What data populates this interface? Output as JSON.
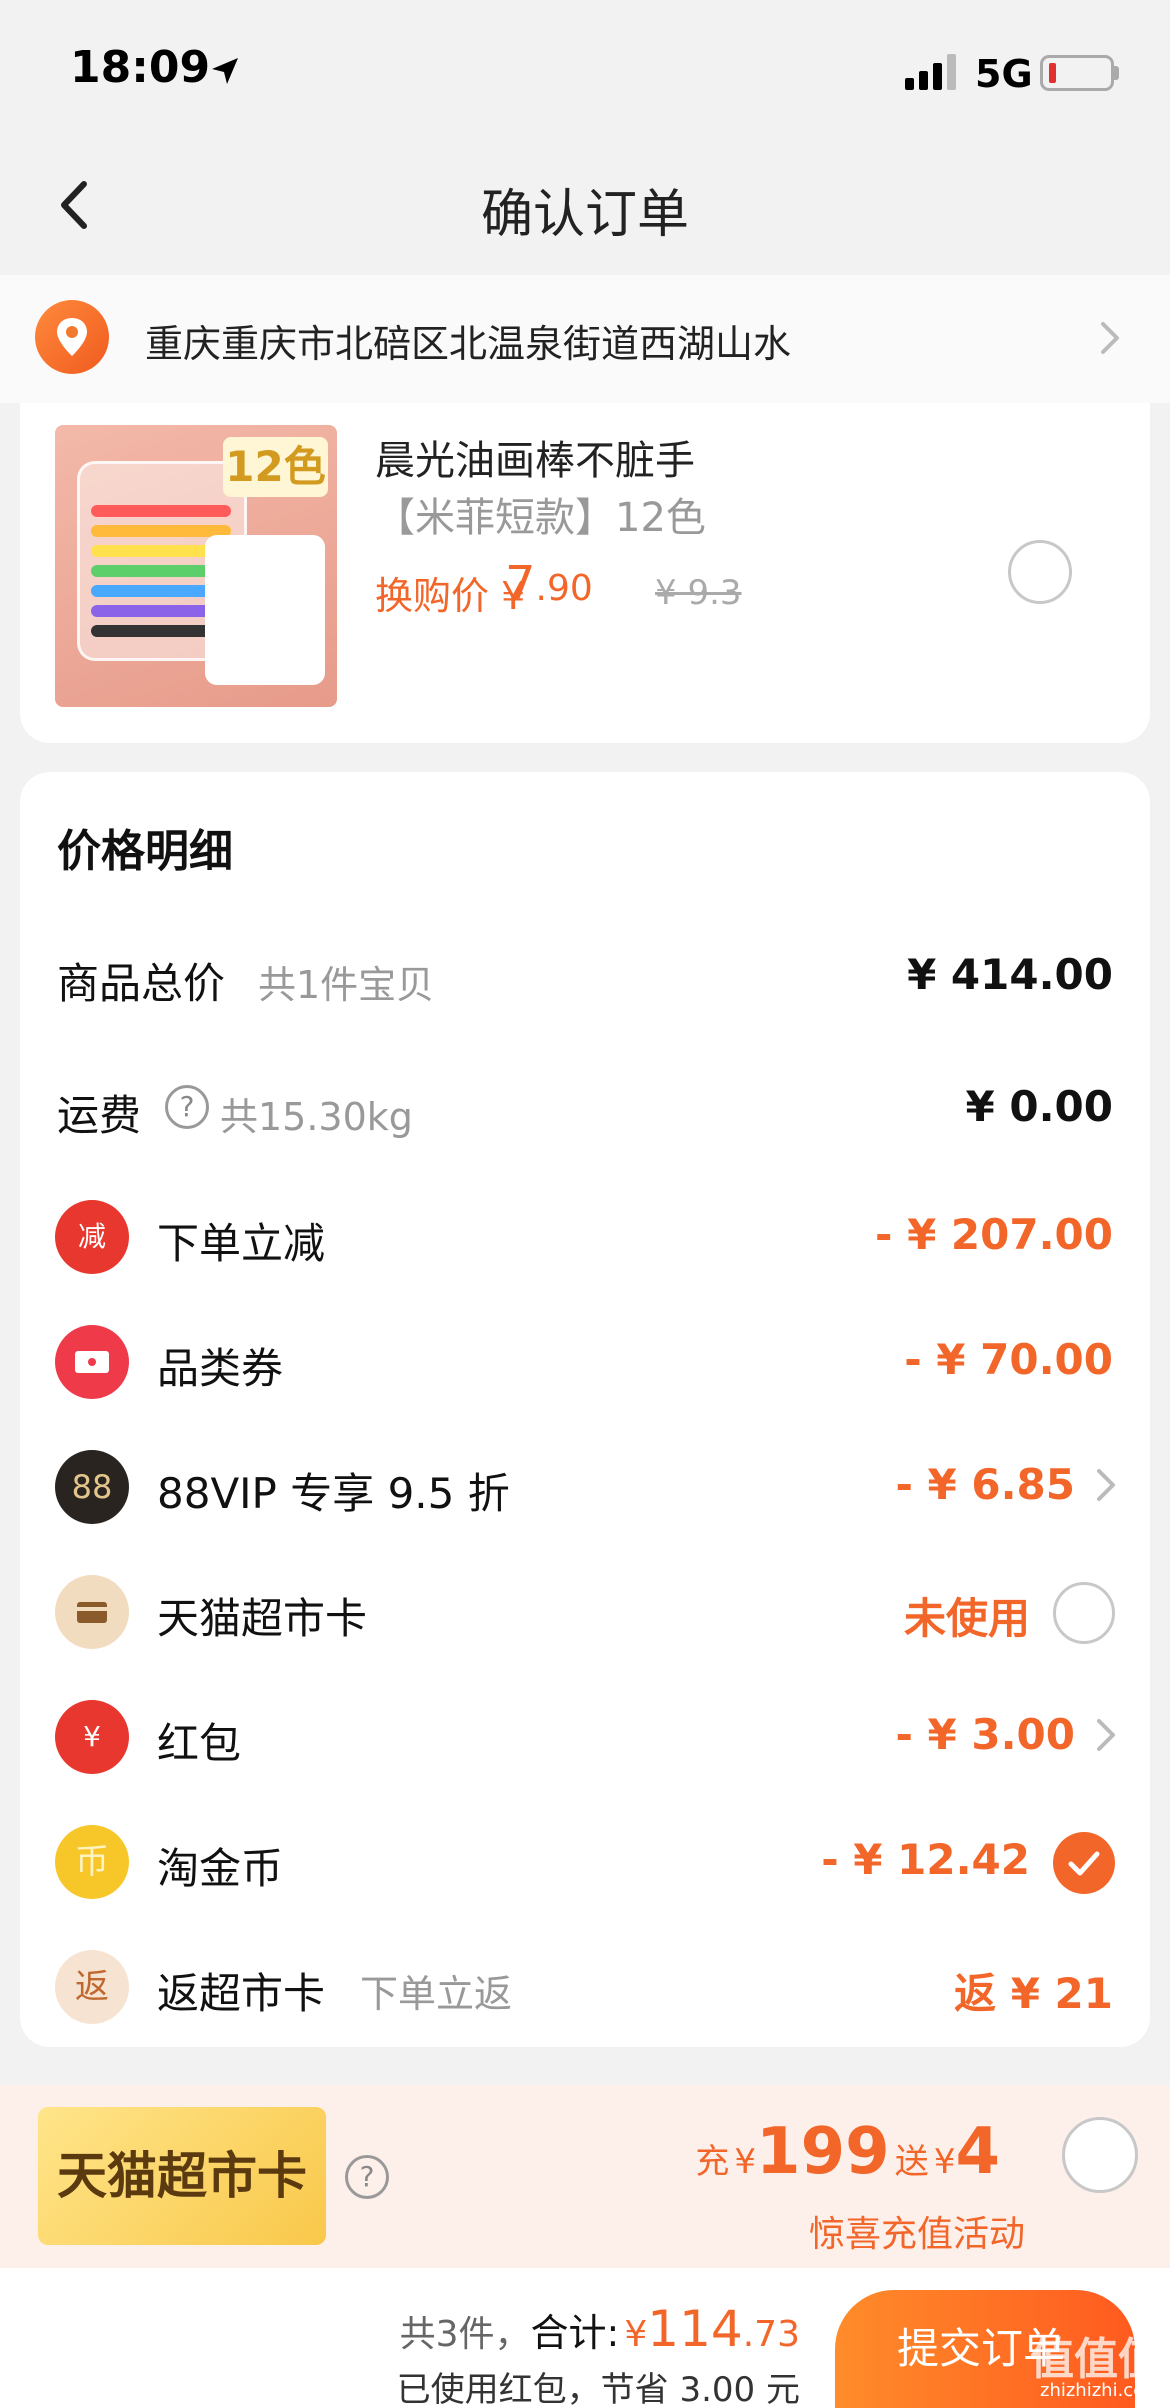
{
  "status_bar": {
    "time": "18:09",
    "network": "5G"
  },
  "nav": {
    "title": "确认订单"
  },
  "address": {
    "text": "重庆重庆市北碚区北温泉街道西湖山水"
  },
  "product": {
    "image_badge": "12色",
    "name": "晨光油画棒不脏手",
    "spec": "【米菲短款】12色",
    "price_label": "换购价",
    "price_yen": "¥",
    "price_int": "7",
    "price_dec": ".90",
    "original_price": "¥ 9.3"
  },
  "price_detail": {
    "title": "价格明细",
    "rows": [
      {
        "label": "商品总价",
        "sub": "共1件宝贝",
        "value": "¥ 414.00"
      },
      {
        "label": "运费",
        "sub": "共15.30kg",
        "value": "¥ 0.00"
      },
      {
        "label": "下单立减",
        "icon_text": "减",
        "value": "- ¥ 207.00"
      },
      {
        "label": "品类券",
        "value": "- ¥ 70.00"
      },
      {
        "label": "88VIP 专享 9.5 折",
        "icon_text": "88",
        "value": "- ¥ 6.85"
      },
      {
        "label": "天猫超市卡",
        "value": "未使用"
      },
      {
        "label": "红包",
        "icon_text": "¥",
        "value": "- ¥ 3.00"
      },
      {
        "label": "淘金币",
        "icon_text": "币",
        "value": "- ¥ 12.42"
      },
      {
        "label": "返超市卡",
        "sub": "下单立返",
        "icon_text": "返",
        "value": "返 ¥ 21"
      }
    ]
  },
  "tmall_card": {
    "logo_text": "天猫超市卡",
    "help": "?",
    "charge_label": "充",
    "yen": "¥",
    "charge_amount": "199",
    "bonus_label": "送",
    "bonus_amount": "4",
    "subtitle": "惊喜充值活动"
  },
  "footer": {
    "count_text": "共3件，",
    "total_label": "合计:",
    "yen": "¥",
    "total_int": "114",
    "total_dec": ".73",
    "saved_text": "已使用红包，节省 3.00 元",
    "submit_label": "提交订单",
    "watermark": "值值值",
    "watermark_site": "zhizhizhi.com"
  },
  "colors": {
    "accent": "#f2662a",
    "background": "#f2f2f2",
    "card": "#ffffff"
  }
}
